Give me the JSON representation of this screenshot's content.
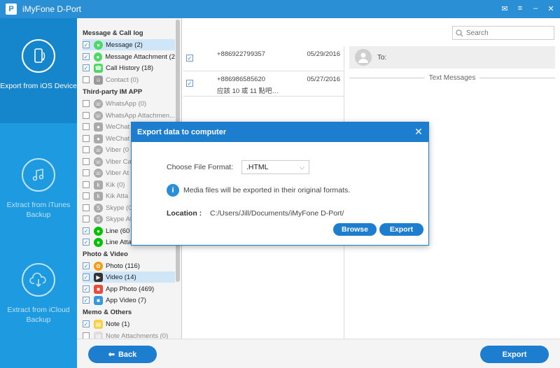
{
  "app": {
    "title": "iMyFone D-Port",
    "logo_letter": "P"
  },
  "window_controls": [
    "✉",
    "≡",
    "–",
    "✕"
  ],
  "nav": [
    {
      "label": "Export from iOS Device",
      "icon": "phone-export-icon"
    },
    {
      "label": "Extract from iTunes Backup",
      "icon": "music-note-icon"
    },
    {
      "label": "Extract from iCloud Backup",
      "icon": "cloud-download-icon"
    }
  ],
  "categories": {
    "message_call_log": {
      "title": "Message & Call log",
      "items": [
        {
          "label": "Message (2)",
          "checked": true,
          "icon": "message-icon"
        },
        {
          "label": "Message Attachment (2",
          "checked": true,
          "icon": "message-icon"
        },
        {
          "label": "Call History (18)",
          "checked": true,
          "icon": "phone-icon"
        },
        {
          "label": "Contact (0)",
          "checked": false,
          "icon": "contact-icon"
        }
      ]
    },
    "third_party": {
      "title": "Third-party IM APP",
      "items": [
        {
          "label": "WhatsApp (0)",
          "checked": false,
          "icon": "whatsapp-icon"
        },
        {
          "label": "WhatsApp Attachmen...",
          "checked": false,
          "icon": "whatsapp-icon"
        },
        {
          "label": "WeChat",
          "checked": false,
          "icon": "wechat-icon"
        },
        {
          "label": "WeChat",
          "checked": false,
          "icon": "wechat-icon"
        },
        {
          "label": "Viber (0",
          "checked": false,
          "icon": "viber-icon"
        },
        {
          "label": "Viber Ca",
          "checked": false,
          "icon": "viber-icon"
        },
        {
          "label": "Viber At",
          "checked": false,
          "icon": "viber-icon"
        },
        {
          "label": "Kik (0)",
          "checked": false,
          "icon": "kik-icon"
        },
        {
          "label": "Kik Atta",
          "checked": false,
          "icon": "kik-icon"
        },
        {
          "label": "Skype (0",
          "checked": false,
          "icon": "skype-icon"
        },
        {
          "label": "Skype At",
          "checked": false,
          "icon": "skype-icon"
        },
        {
          "label": "Line (60",
          "checked": true,
          "icon": "line-icon"
        },
        {
          "label": "Line Atta",
          "checked": true,
          "icon": "line-icon"
        }
      ]
    },
    "photo_video": {
      "title": "Photo & Video",
      "items": [
        {
          "label": "Photo (116)",
          "checked": true,
          "icon": "photo-icon"
        },
        {
          "label": "Video (14)",
          "checked": true,
          "icon": "video-icon"
        },
        {
          "label": "App Photo (469)",
          "checked": true,
          "icon": "app-photo-icon"
        },
        {
          "label": "App Video (7)",
          "checked": true,
          "icon": "app-video-icon"
        }
      ]
    },
    "memo_others": {
      "title": "Memo & Others",
      "items": [
        {
          "label": "Note (1)",
          "checked": true,
          "icon": "note-icon"
        },
        {
          "label": "Note Attachments (0)",
          "checked": false,
          "icon": "note-icon"
        }
      ]
    }
  },
  "search": {
    "placeholder": "Search"
  },
  "messages": [
    {
      "phone": "+886922799357",
      "date": "05/29/2016",
      "preview": "",
      "checked": true
    },
    {
      "phone": "+886986585620",
      "date": "05/27/2016",
      "preview": "应該 10 或 11 點吧…",
      "checked": true
    }
  ],
  "detail": {
    "to_label": "To:",
    "section": "Text Messages"
  },
  "bottom": {
    "back": "Back",
    "export": "Export"
  },
  "dialog": {
    "title": "Export data to computer",
    "format_label": "Choose File Format:",
    "format_value": ".HTML",
    "info": "Media files will be exported in their original formats.",
    "location_label": "Location :",
    "location_path": "C:/Users/Jill/Documents/iMyFone D-Port/",
    "browse": "Browse",
    "export": "Export"
  },
  "colors": {
    "primary": "#1d7ed0",
    "titlebar": "#2b8fd6",
    "nav": "#1d9ae0"
  }
}
